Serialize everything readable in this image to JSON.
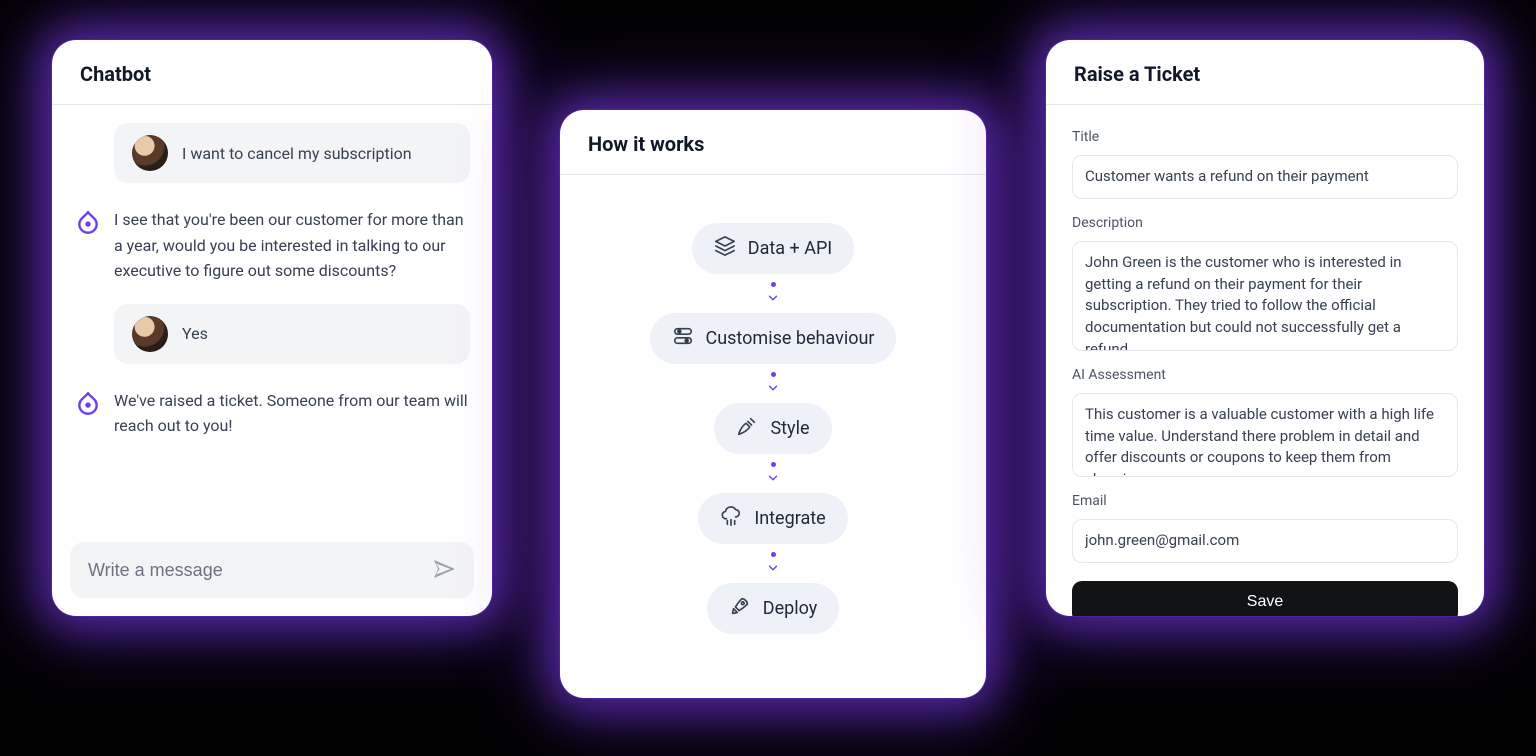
{
  "chat": {
    "title": "Chatbot",
    "messages": {
      "user1": "I want to cancel my subscription",
      "bot1": "I see that you're been our customer for more than a year, would you be interested in talking to our executive to figure out some discounts?",
      "user2": "Yes",
      "bot2": "We've raised a ticket. Someone from our team will reach out to you!"
    },
    "input_placeholder": "Write a message"
  },
  "how_it_works": {
    "title": "How it works",
    "steps": {
      "s1": "Data + API",
      "s2": "Customise behaviour",
      "s3": "Style",
      "s4": "Integrate",
      "s5": "Deploy"
    }
  },
  "ticket": {
    "title": "Raise a Ticket",
    "labels": {
      "title": "Title",
      "description": "Description",
      "assessment": "AI Assessment",
      "email": "Email"
    },
    "values": {
      "title": "Customer wants a refund on their payment",
      "description": "John Green is the customer who is interested in getting a refund on their payment for their subscription. They tried to follow the official documentation but could not successfully get a refund.",
      "assessment": "This customer is a valuable customer with a high life time value. Understand there problem in detail and offer discounts or coupons to keep them from churning.",
      "email": "john.green@gmail.com"
    },
    "save_label": "Save"
  }
}
